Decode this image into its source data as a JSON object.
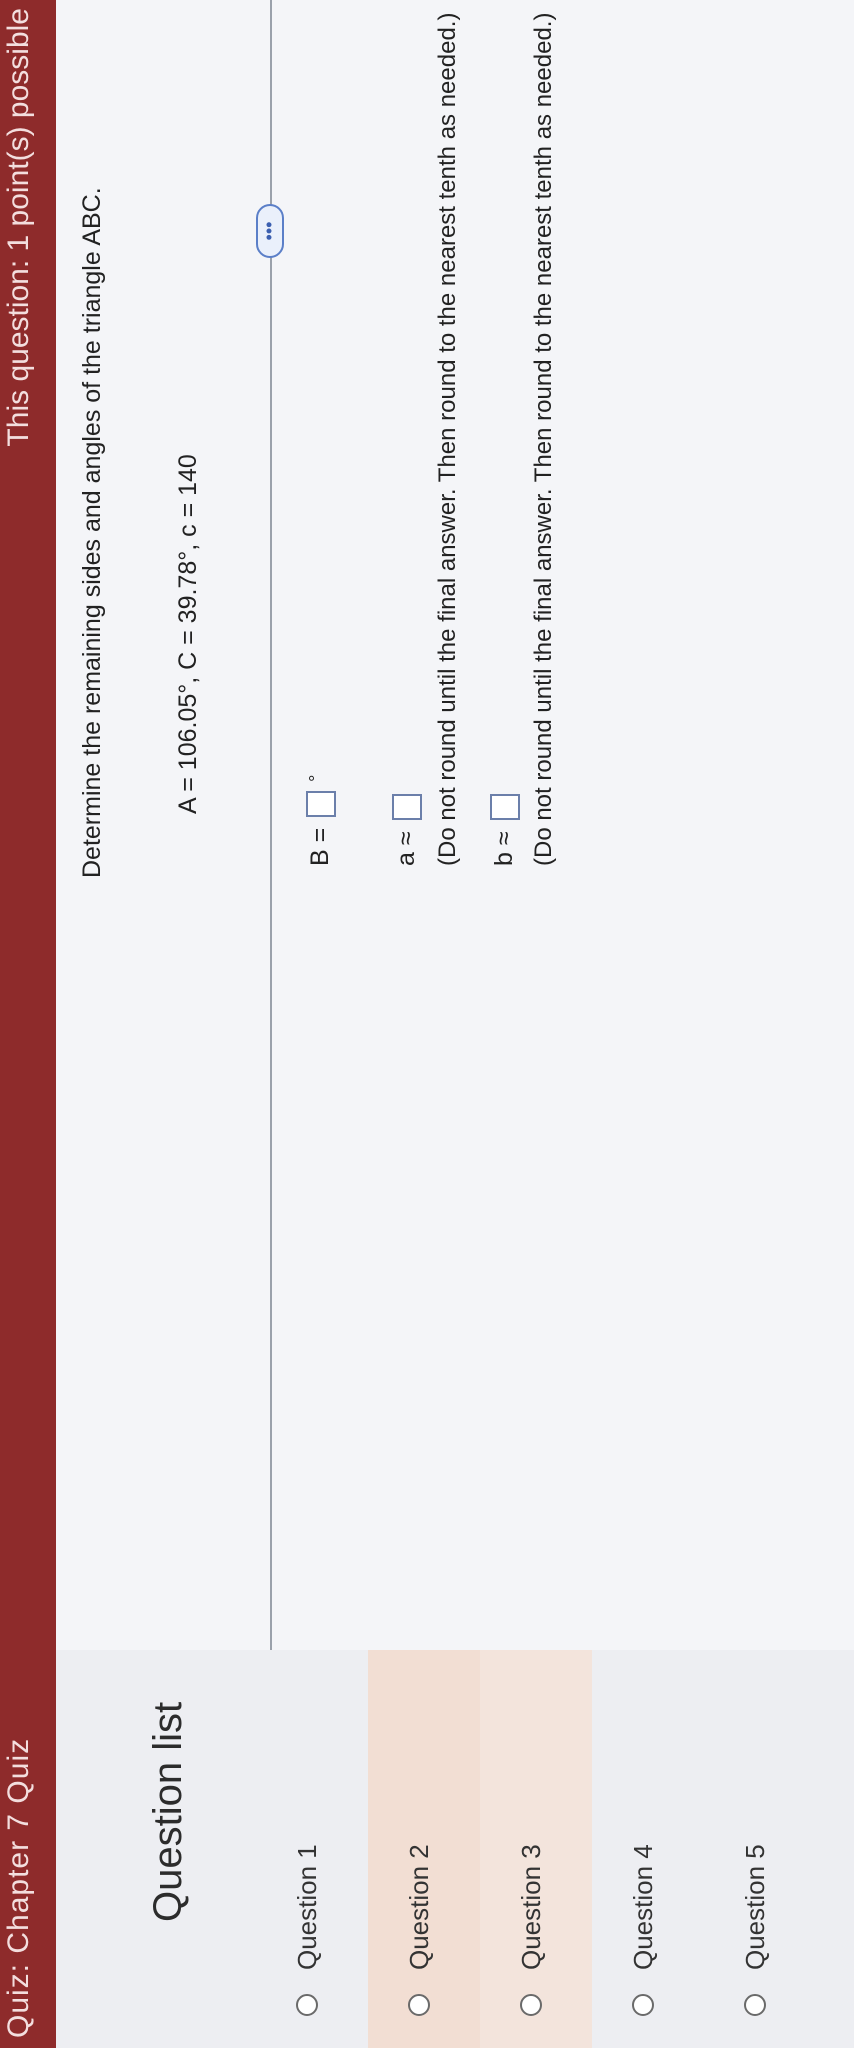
{
  "header": {
    "title": "Quiz: Chapter 7 Quiz",
    "points": "This question: 1 point(s) possible"
  },
  "sidebar": {
    "title": "Question list",
    "items": [
      {
        "label": "Question 1"
      },
      {
        "label": "Question 2"
      },
      {
        "label": "Question 3"
      },
      {
        "label": "Question 4"
      },
      {
        "label": "Question 5"
      }
    ]
  },
  "question": {
    "prompt": "Determine the remaining sides and angles of the triangle ABC.",
    "givens": "A = 106.05°, C = 39.78°, c = 140",
    "more_label": "•••",
    "b_angle_label": "B =",
    "b_angle_unit": "°",
    "a_label": "a ≈",
    "a_note": "(Do not round until the final answer. Then round to the nearest tenth as needed.)",
    "b_label": "b ≈",
    "b_note": "(Do not round until the final answer. Then round to the nearest tenth as needed.)"
  },
  "icons": {
    "collapse": "collapse-left-icon",
    "cursor": "hand-cursor-icon"
  },
  "colors": {
    "header": "#8e2b2b",
    "active_item": "#f2ded3"
  }
}
